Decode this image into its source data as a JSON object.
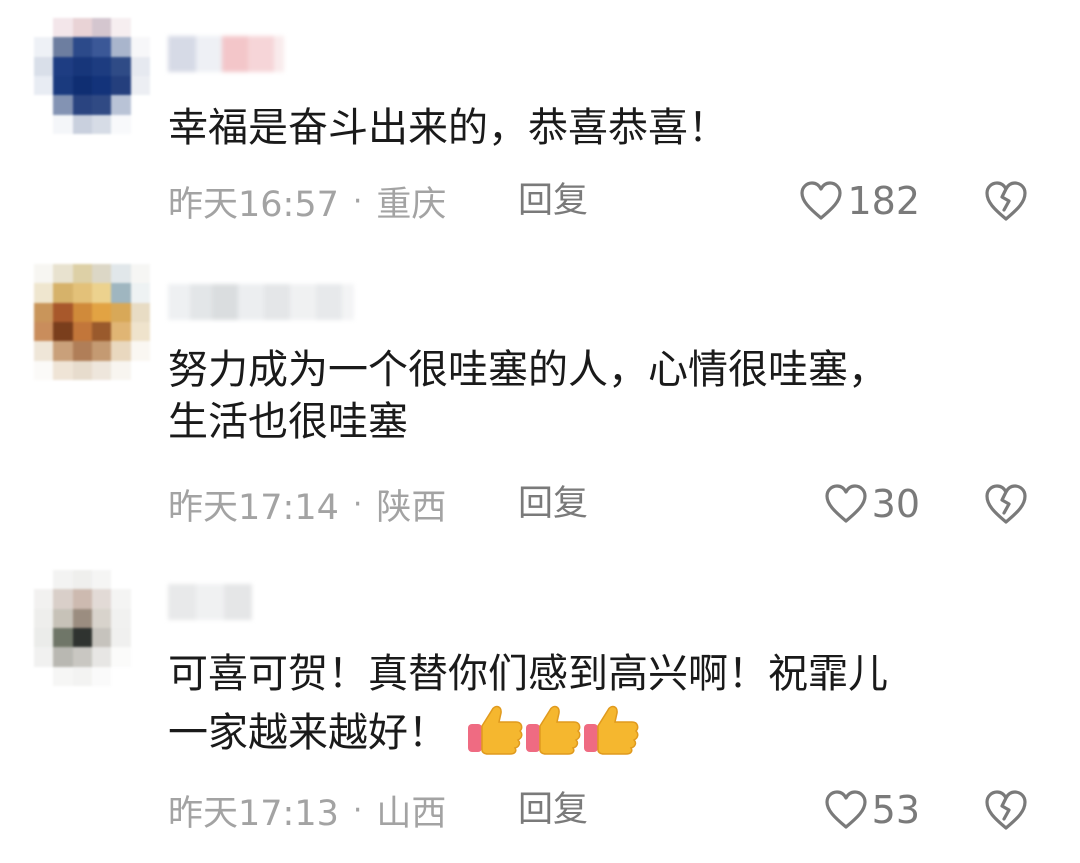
{
  "colors": {
    "text": "#1a1a1a",
    "meta": "#a3a3a3",
    "action": "#7a7a7a",
    "thumb_yellow": "#f5b72f",
    "thumb_pink": "#ef6b82"
  },
  "comments": [
    {
      "content": "幸福是奋斗出来的，恭喜恭喜！",
      "time": "昨天16:57",
      "separator": "·",
      "location": "重庆",
      "reply_label": "回复",
      "like_count": "182",
      "like_icon": "heart-outline-icon",
      "dislike_icon": "broken-heart-icon"
    },
    {
      "content": "努力成为一个很哇塞的人，心情很哇塞，\n生活也很哇塞",
      "time": "昨天17:14",
      "separator": "·",
      "location": "陕西",
      "reply_label": "回复",
      "like_count": "30",
      "like_icon": "heart-outline-icon",
      "dislike_icon": "broken-heart-icon"
    },
    {
      "content": "可喜可贺！真替你们感到高兴啊！祝霏儿\n一家越来越好！",
      "emoji": [
        "thumbs-up-icon",
        "thumbs-up-icon",
        "thumbs-up-icon"
      ],
      "time": "昨天17:13",
      "separator": "·",
      "location": "山西",
      "reply_label": "回复",
      "like_count": "53",
      "like_icon": "heart-outline-icon",
      "dislike_icon": "broken-heart-icon"
    }
  ]
}
